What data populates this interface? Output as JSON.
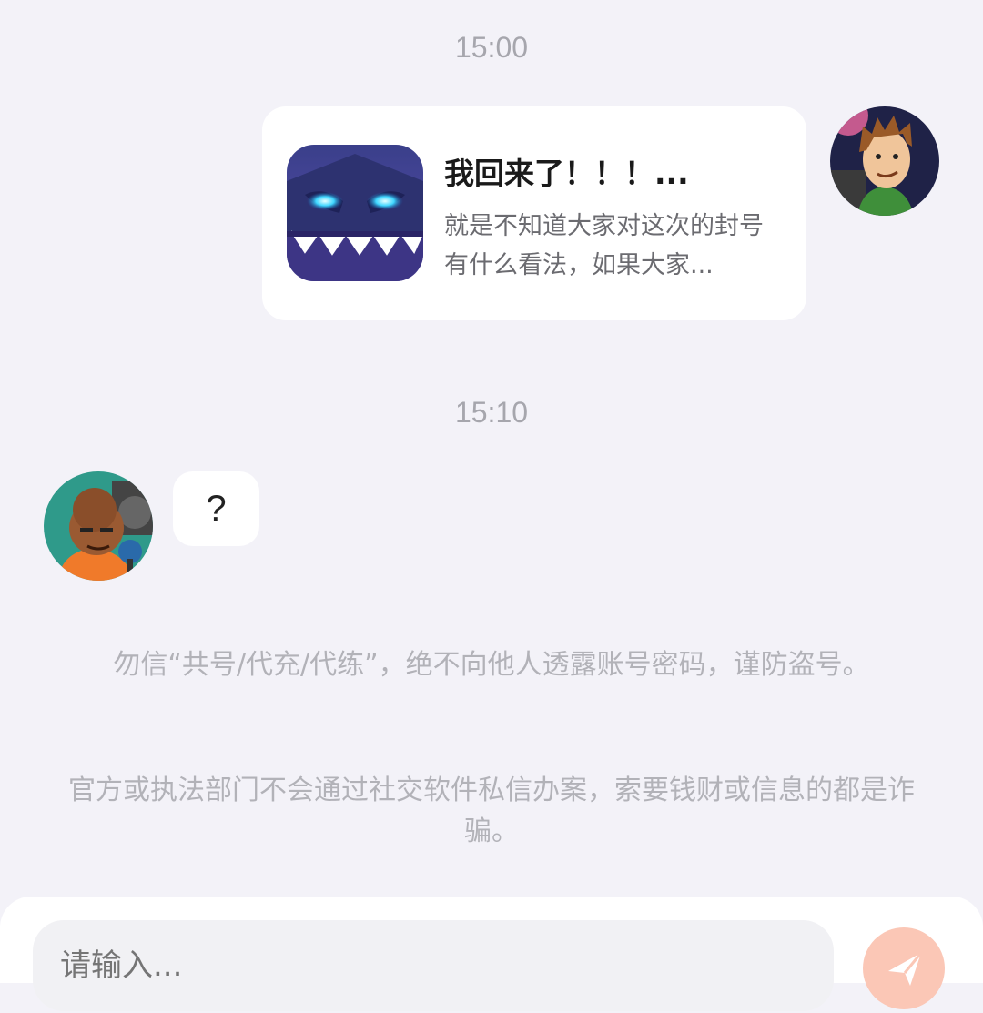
{
  "chat": {
    "time_1": "15:00",
    "share_card": {
      "title": "我回来了！！！...",
      "description": "就是不知道大家对这次的封号有什么看法，如果大家..."
    },
    "time_2": "15:10",
    "incoming_message": "?"
  },
  "notices": {
    "warning_1": "勿信“共号/代充/代练”，绝不向他人透露账号密码，谨防盗号。",
    "warning_2": "官方或执法部门不会通过社交软件私信办案，索要钱财或信息的都是诈骗。"
  },
  "composer": {
    "placeholder": "请输入..."
  },
  "icons": {
    "send": "send-icon",
    "thumbnail": "shark-monster-thumbnail",
    "avatar_me": "cartoon-man-avatar",
    "avatar_other": "cartoon-man-microphone-avatar"
  },
  "colors": {
    "background": "#f3f2f8",
    "send_button": "#fbc7b6",
    "send_arrow": "#ffffff"
  }
}
